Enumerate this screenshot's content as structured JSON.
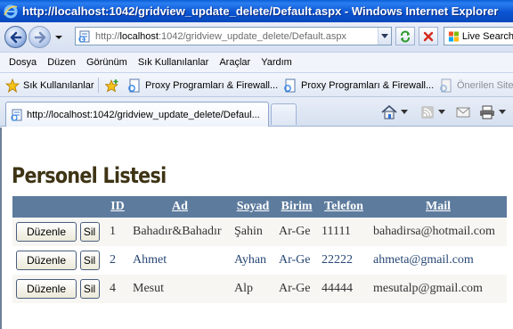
{
  "window": {
    "title": "http://localhost:1042/gridview_update_delete/Default.aspx - Windows Internet Explorer"
  },
  "address": {
    "url_prefix": "http://",
    "url_host": "localhost",
    "url_rest": ":1042/gridview_update_delete/Default.aspx",
    "search_label": "Live Search"
  },
  "menu": {
    "items": [
      "Dosya",
      "Düzen",
      "Görünüm",
      "Sık Kullanılanlar",
      "Araçlar",
      "Yardım"
    ]
  },
  "favorites": {
    "favorites_label": "Sık Kullanılanlar",
    "links": [
      "Proxy Programları & Firewall...",
      "Proxy Programları & Firewall...",
      "Önerilen Siteler"
    ]
  },
  "tab": {
    "label": "http://localhost:1042/gridview_update_delete/Defaul..."
  },
  "page": {
    "heading": "Personel Listesi",
    "columns": [
      "ID",
      "Ad",
      "Soyad",
      "Birim",
      "Telefon",
      "Mail"
    ],
    "edit_label": "Düzenle",
    "delete_label": "Sil",
    "rows": [
      {
        "id": "1",
        "ad": "Bahadır&Bahadır",
        "soyad": "Şahin",
        "birim": "Ar-Ge",
        "telefon": "11111",
        "mail": "bahadirsa@hotmail.com"
      },
      {
        "id": "2",
        "ad": "Ahmet",
        "soyad": "Ayhan",
        "birim": "Ar-Ge",
        "telefon": "22222",
        "mail": "ahmeta@gmail.com"
      },
      {
        "id": "4",
        "ad": "Mesut",
        "soyad": "Alp",
        "birim": "Ar-Ge",
        "telefon": "44444",
        "mail": "mesutalp@gmail.com"
      }
    ]
  },
  "colors": {
    "header_bg": "#5d7b9d",
    "row_odd_bg": "#f7f6f3",
    "row_even_text": "#284775",
    "heading_text": "#3e3414"
  },
  "icons": {
    "title": "ie-logo-icon",
    "back": "back-arrow-icon",
    "forward": "forward-arrow-icon",
    "refresh": "refresh-icon",
    "stop": "stop-icon",
    "favorites": "star-icon",
    "add_favorite": "add-favorite-icon",
    "page": "page-icon",
    "home": "home-icon",
    "feeds": "rss-feed-icon",
    "mail": "mail-icon",
    "print": "printer-icon"
  }
}
